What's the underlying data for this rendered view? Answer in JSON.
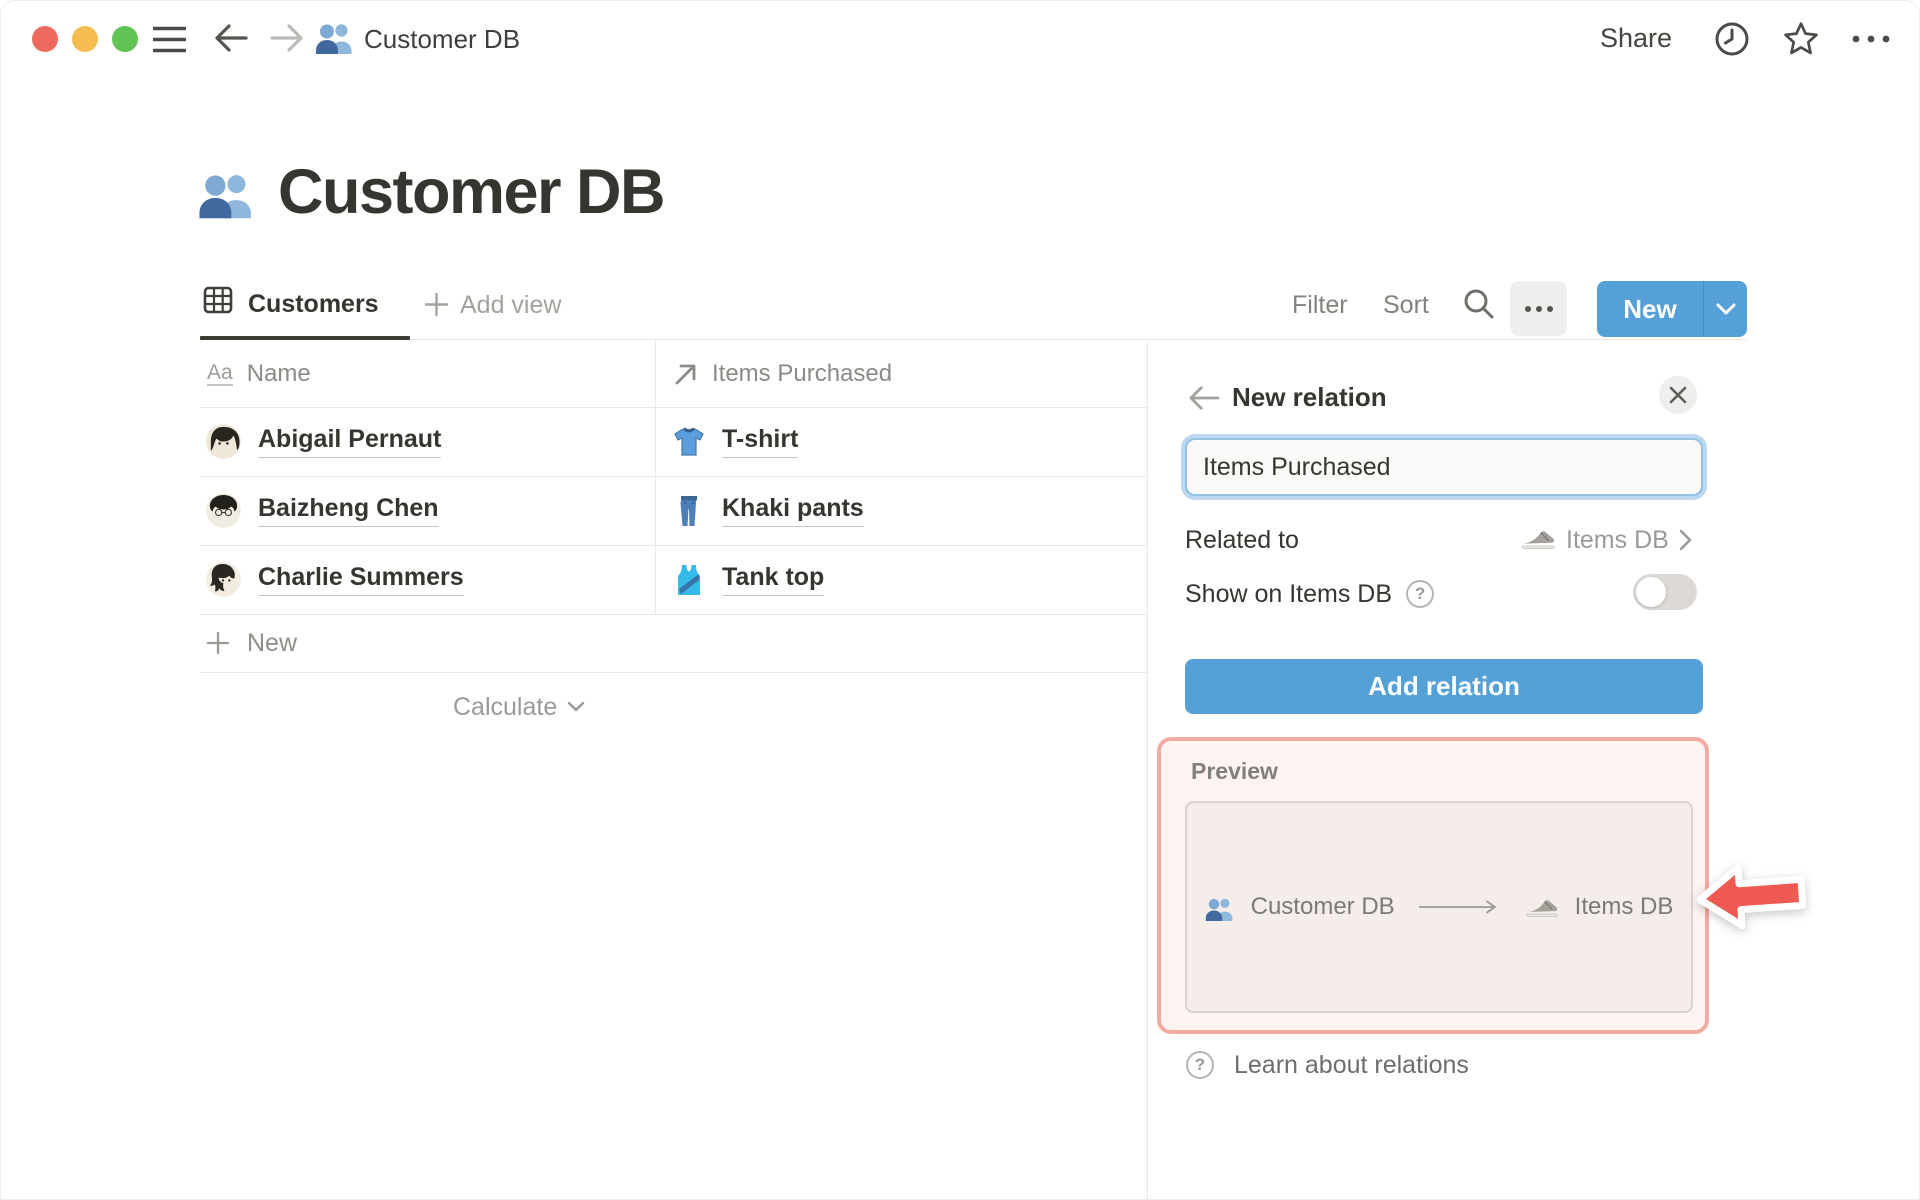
{
  "titlebar": {
    "title": "Customer DB",
    "share_label": "Share"
  },
  "page": {
    "icon": "people-icon",
    "title": "Customer DB"
  },
  "toolbar": {
    "tab_label": "Customers",
    "add_view_label": "Add view",
    "filter_label": "Filter",
    "sort_label": "Sort",
    "new_label": "New"
  },
  "table": {
    "headers": [
      {
        "icon": "text-property-icon",
        "label": "Name"
      },
      {
        "icon": "relation-arrow-icon",
        "label": "Items Purchased"
      }
    ],
    "rows": [
      {
        "avatar": "avatar-abigail",
        "name": "Abigail Pernaut",
        "item_icon": "tshirt-icon",
        "item": "T-shirt"
      },
      {
        "avatar": "avatar-baizheng",
        "name": "Baizheng Chen",
        "item_icon": "jeans-icon",
        "item": "Khaki pants"
      },
      {
        "avatar": "avatar-charlie",
        "name": "Charlie Summers",
        "item_icon": "tanktop-icon",
        "item": "Tank top"
      }
    ],
    "new_row_label": "New",
    "calculate_label": "Calculate"
  },
  "panel": {
    "title": "New relation",
    "name_input": {
      "value": "Items Purchased"
    },
    "related": {
      "label": "Related to",
      "value_icon": "sneaker-icon",
      "value": "Items DB"
    },
    "show_on": {
      "label": "Show on Items DB",
      "state": "off"
    },
    "add_button_label": "Add relation",
    "preview": {
      "label": "Preview",
      "source_icon": "people-icon",
      "source": "Customer DB",
      "target_icon": "sneaker-icon",
      "target": "Items DB"
    },
    "learn_label": "Learn about relations"
  },
  "colors": {
    "accent_blue": "#55a0d6",
    "focus_ring_blue": "#bcd8f0",
    "highlight_pink_border": "#f2aba4",
    "highlight_pink_bg": "#fdf3f1",
    "annotation_red": "#ee5a52",
    "ink": "#37352f",
    "traffic_red": "#ee6a5f",
    "traffic_yellow": "#f5bd4f",
    "traffic_green": "#61c354"
  }
}
